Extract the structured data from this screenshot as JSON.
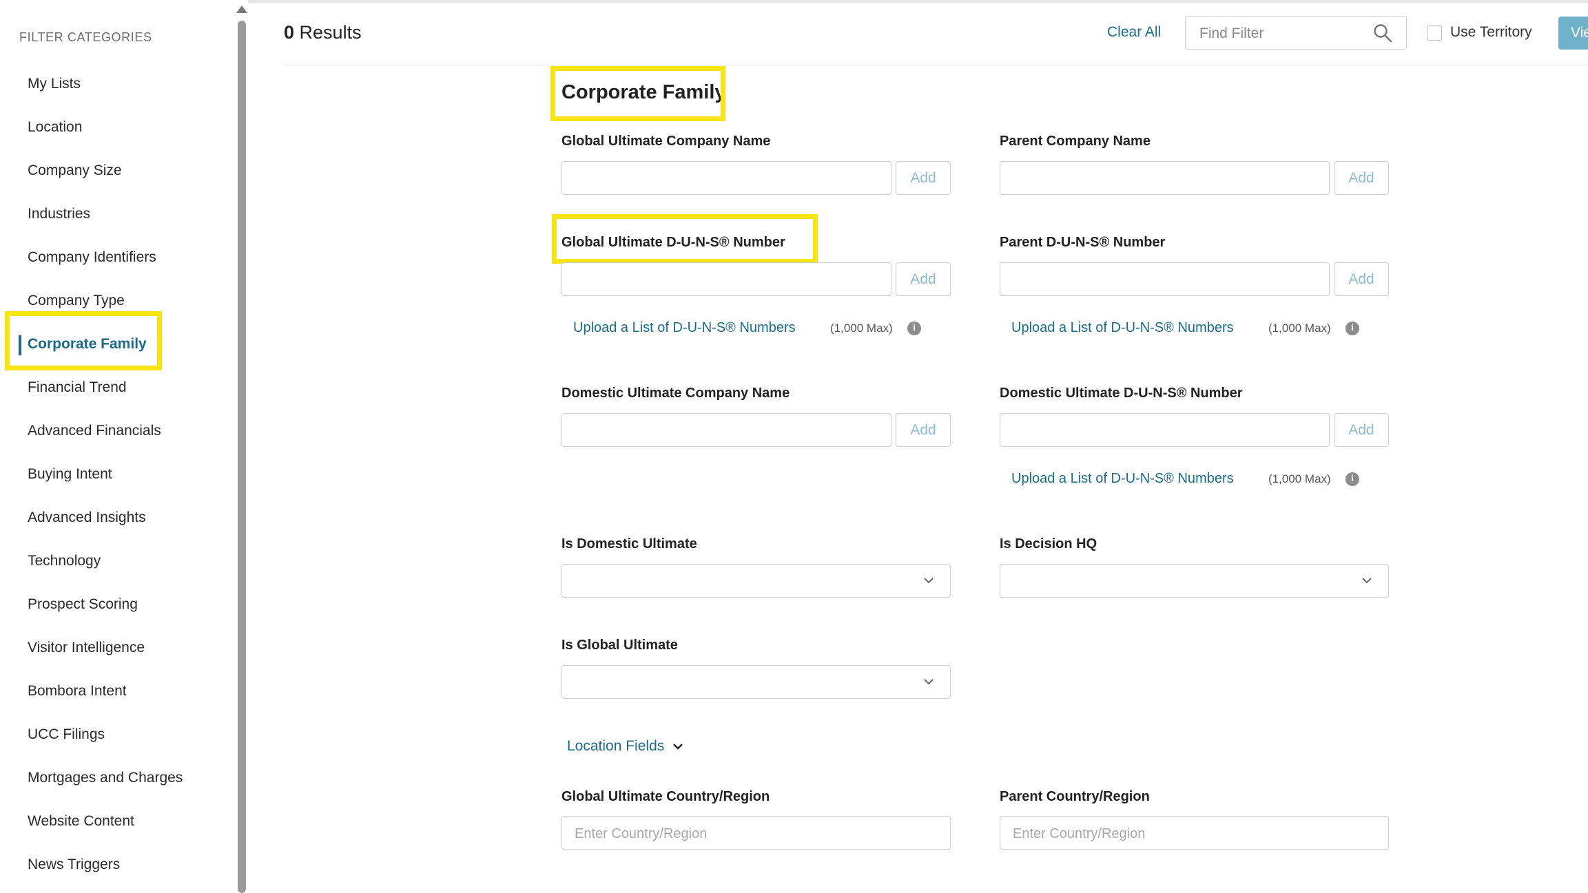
{
  "sidebar": {
    "heading": "FILTER CATEGORIES",
    "items": [
      {
        "label": "My Lists"
      },
      {
        "label": "Location"
      },
      {
        "label": "Company Size"
      },
      {
        "label": "Industries"
      },
      {
        "label": "Company Identifiers"
      },
      {
        "label": "Company Type"
      },
      {
        "label": "Corporate Family",
        "active": true
      },
      {
        "label": "Financial Trend"
      },
      {
        "label": "Advanced Financials"
      },
      {
        "label": "Buying Intent"
      },
      {
        "label": "Advanced Insights"
      },
      {
        "label": "Technology"
      },
      {
        "label": "Prospect Scoring"
      },
      {
        "label": "Visitor Intelligence"
      },
      {
        "label": "Bombora Intent"
      },
      {
        "label": "UCC Filings"
      },
      {
        "label": "Mortgages and Charges"
      },
      {
        "label": "Website Content"
      },
      {
        "label": "News Triggers"
      }
    ]
  },
  "header": {
    "results_count": "0",
    "results_label": "Results",
    "clear_all": "Clear All",
    "find_filter_placeholder": "Find Filter",
    "use_territory": "Use Territory",
    "view_button": "View"
  },
  "section": {
    "title": "Corporate Family",
    "add_label": "Add",
    "upload_label": "Upload a List of D-U-N-S® Numbers",
    "max_note": "(1,000 Max)",
    "info_glyph": "i",
    "fields": {
      "global_ultimate_company_name": "Global Ultimate Company Name",
      "parent_company_name": "Parent Company Name",
      "global_ultimate_duns": "Global Ultimate D-U-N-S® Number",
      "parent_duns": "Parent D-U-N-S® Number",
      "domestic_ultimate_company_name": "Domestic Ultimate Company Name",
      "domestic_ultimate_duns": "Domestic Ultimate D-U-N-S® Number",
      "is_domestic_ultimate": "Is Domestic Ultimate",
      "is_decision_hq": "Is Decision HQ",
      "is_global_ultimate": "Is Global Ultimate",
      "location_fields": "Location Fields",
      "global_ultimate_country": "Global Ultimate Country/Region",
      "parent_country": "Parent Country/Region",
      "country_placeholder": "Enter Country/Region"
    }
  },
  "colors": {
    "accent": "#1a6b8a",
    "highlight": "#f7e511",
    "view_button": "#6fb1c9"
  }
}
